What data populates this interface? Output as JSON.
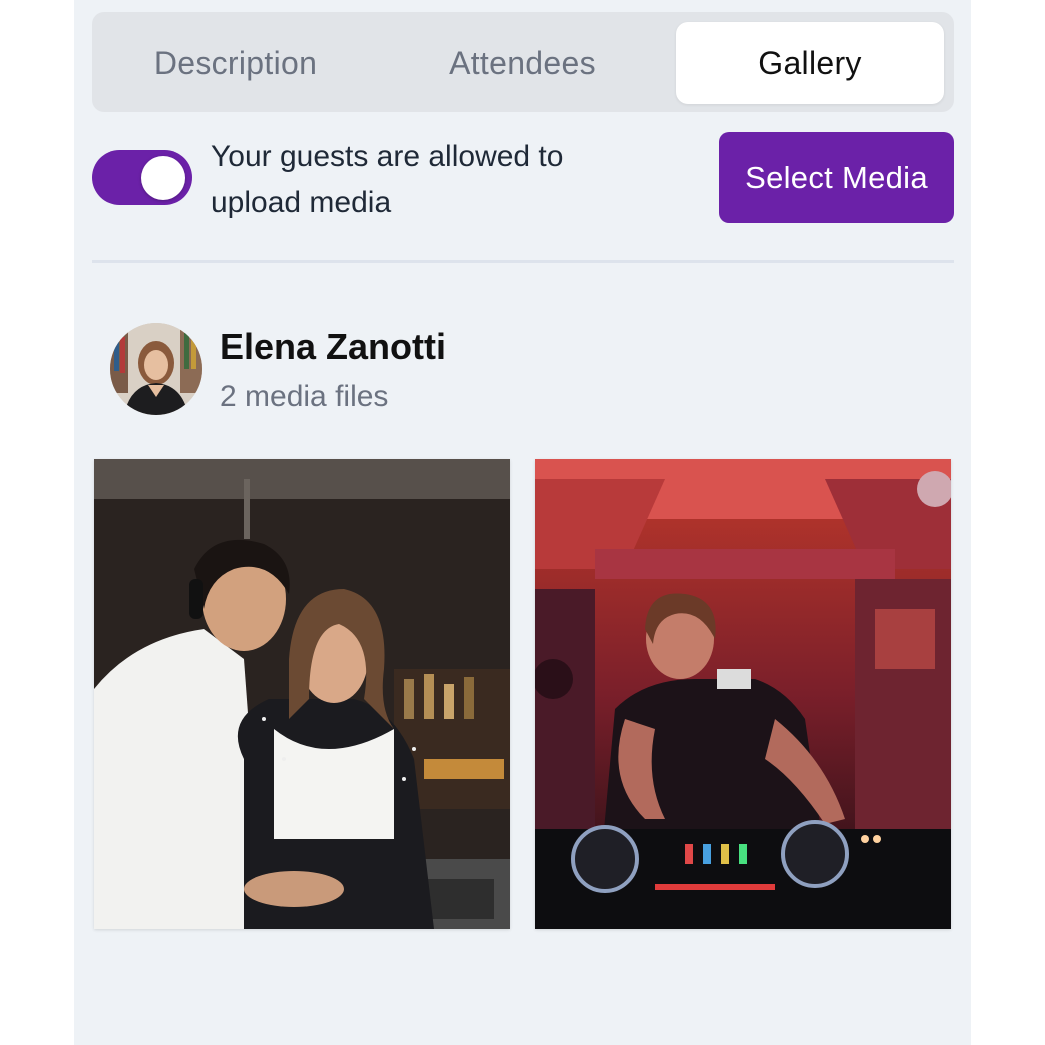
{
  "tabs": [
    {
      "label": "Description",
      "active": false
    },
    {
      "label": "Attendees",
      "active": false
    },
    {
      "label": "Gallery",
      "active": true
    }
  ],
  "upload_toggle": {
    "label": "Your guests are allowed to upload media",
    "enabled": true
  },
  "select_media_button": {
    "label": "Select Media"
  },
  "uploader": {
    "name": "Elena Zanotti",
    "count_text": "2 media files"
  },
  "media": [
    {
      "description_icon": "photo-dj-couple"
    },
    {
      "description_icon": "photo-dj-red-room"
    }
  ],
  "colors": {
    "accent": "#6b21a8",
    "panel_bg": "#eef2f6",
    "tab_bg": "#e1e4e8",
    "muted_text": "#6b7280"
  }
}
